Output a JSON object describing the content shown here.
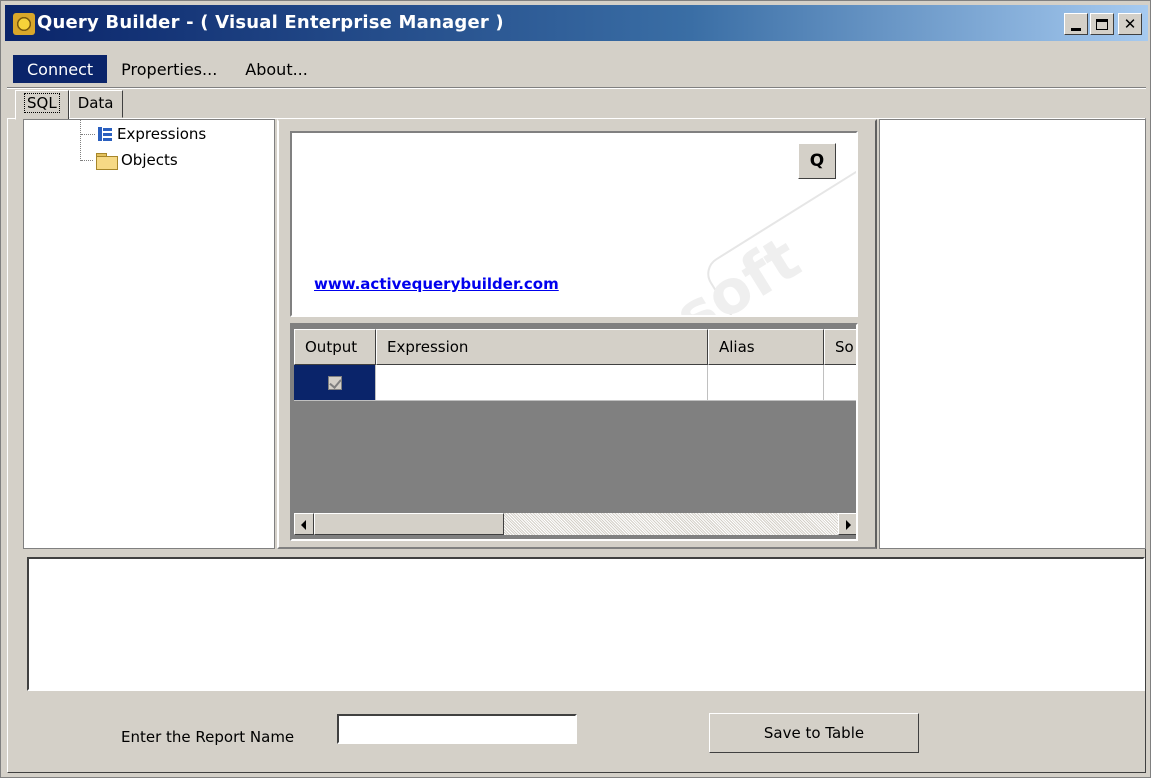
{
  "window": {
    "title": "Query Builder - ( Visual Enterprise Manager )",
    "title_icon": "gear-app-icon",
    "caption_buttons": [
      "minimize",
      "maximize",
      "close"
    ]
  },
  "menu": {
    "items": [
      {
        "label": "Connect",
        "active": true
      },
      {
        "label": "Properties..."
      },
      {
        "label": "About..."
      }
    ]
  },
  "tabs": [
    {
      "label": "SQL",
      "selected": true
    },
    {
      "label": "Data"
    }
  ],
  "tree": {
    "items": [
      {
        "label": "Expressions",
        "icon": "tree-structure-icon"
      },
      {
        "label": "Objects",
        "icon": "folder-icon"
      }
    ]
  },
  "designer": {
    "query_button_label": "Q",
    "link_text": "www.activequerybuilder.com"
  },
  "grid": {
    "columns": [
      "Output",
      "Expression",
      "Alias",
      "So"
    ],
    "rows": [
      {
        "output": true,
        "expression": "",
        "alias": "",
        "sort": ""
      }
    ]
  },
  "footer": {
    "report_label": "Enter the Report Name",
    "report_value": "",
    "save_label": "Save to Table"
  },
  "colors": {
    "selection": "#0a246a",
    "face": "#d4d0c8",
    "link": "#0000ee"
  }
}
